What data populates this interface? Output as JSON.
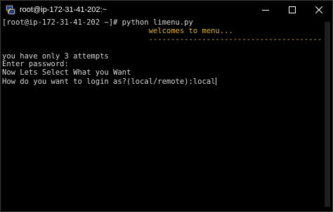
{
  "window": {
    "title": "root@ip-172-31-41-202:~",
    "accent": "#d4b02a"
  },
  "controls": {
    "minimize_icon": "minimize-icon",
    "maximize_icon": "maximize-icon",
    "close_icon": "close-icon"
  },
  "terminal": {
    "lines": [
      "[root@ip-172-31-41-202 ~]# python limenu.py",
      "                                 welcomes to menu...",
      "                                 ------------------------------------------",
      "",
      "you have only 3 attempts",
      "Enter password:",
      "Now Lets Select What you Want",
      "How do you want to login as?(local/remote):local"
    ]
  }
}
